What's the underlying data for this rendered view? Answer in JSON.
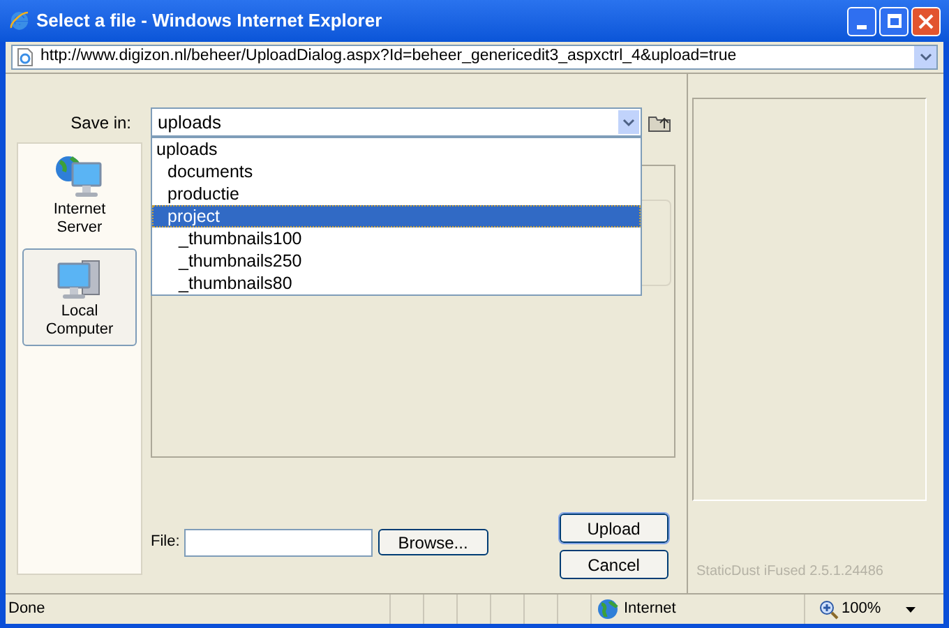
{
  "window": {
    "title": "Select a file - Windows Internet Explorer"
  },
  "address_bar": {
    "url": "http://www.digizon.nl/beheer/UploadDialog.aspx?Id=beheer_genericedit3_aspxctrl_4&upload=true"
  },
  "save_in": {
    "label": "Save in:",
    "value": "uploads",
    "expanded": true
  },
  "folders": [
    {
      "name": "uploads",
      "selected": false,
      "children": [
        {
          "name": "documents",
          "selected": false
        },
        {
          "name": "productie",
          "selected": false
        },
        {
          "name": "project",
          "selected": true,
          "children": [
            {
              "name": "_thumbnails100",
              "selected": false
            },
            {
              "name": "_thumbnails250",
              "selected": false
            },
            {
              "name": "_thumbnails80",
              "selected": false
            }
          ]
        }
      ]
    }
  ],
  "places": [
    {
      "label": "Internet Server",
      "kind": "server",
      "selected": false
    },
    {
      "label": "Local Computer",
      "kind": "computer",
      "selected": true
    }
  ],
  "file_field": {
    "label": "File:",
    "browse": "Browse..."
  },
  "buttons": [
    "Upload",
    "Cancel"
  ],
  "version": "StaticDust iFused 2.5.1.24486",
  "status_bar": {
    "status": "Done",
    "zone": "Internet",
    "zoom": "100%"
  }
}
